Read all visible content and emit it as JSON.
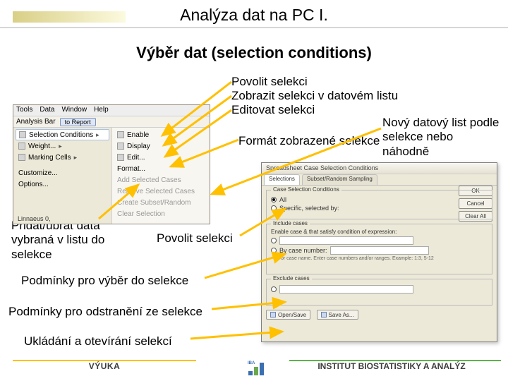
{
  "title": "Analýza dat na PC I.",
  "subtitle": "Výběr dat (selection conditions)",
  "labels": {
    "l1": "Povolit selekci",
    "l2": "Zobrazit selekci v datovém listu",
    "l3": "Editovat selekci",
    "l4": "Formát zobrazené selekce",
    "l5": "Nový datový list podle selekce nebo náhodně",
    "l6": "Přidat/ubrat data vybraná v listu do selekce",
    "l7": "Povolit selekci",
    "l8": "Podmínky pro výběr do selekce",
    "l9": "Podmínky pro odstranění ze selekce",
    "l10": "Ukládání a otevírání selekcí"
  },
  "menu": {
    "top": [
      "Tools",
      "Data",
      "Window",
      "Help"
    ],
    "analysisBar": "Analysis Bar",
    "toReport": "to Report",
    "left": [
      {
        "t": "Selection Conditions",
        "sel": true,
        "sub": true
      },
      {
        "t": "Weight...",
        "sub": true
      },
      {
        "t": "Marking Cells",
        "sub": true
      },
      {
        "t": "Customize...",
        "sub": false
      },
      {
        "t": "Options...",
        "sub": false
      }
    ],
    "right": [
      {
        "t": "Enable"
      },
      {
        "t": "Display"
      },
      {
        "t": "Edit..."
      },
      {
        "t": "Format..."
      },
      {
        "t": "Add Selected Cases",
        "dis": true
      },
      {
        "t": "Remove Selected Cases",
        "dis": true
      },
      {
        "t": "Create Subset/Random",
        "dis": true
      },
      {
        "t": "Clear Selection",
        "dis": true
      }
    ],
    "extra": "Linnaeus  0,"
  },
  "dialog": {
    "caption": "Spreadsheet Case Selection Conditions",
    "tabs": [
      "Selections",
      "Subset/Random Sampling"
    ],
    "group1": "Case Selection Conditions",
    "r_all": "All",
    "r_spec": "Specific, selected by:",
    "group2": "Include cases",
    "exprLabel": "Enable case & that satisfy condition of expression:",
    "byCase": "By case number:",
    "byCaseHint": "or case name. Enter case numbers and/or ranges. Example: 1:3, 5-12",
    "group3": "Exclude cases",
    "ok": "OK",
    "cancel": "Cancel",
    "clearAll": "Clear All",
    "open": "Open/Save",
    "saveAs": "Save As..."
  },
  "footer": {
    "left": "VÝUKA",
    "right": "INSTITUT BIOSTATISTIKY A ANALÝZ",
    "logo": "IBA"
  }
}
